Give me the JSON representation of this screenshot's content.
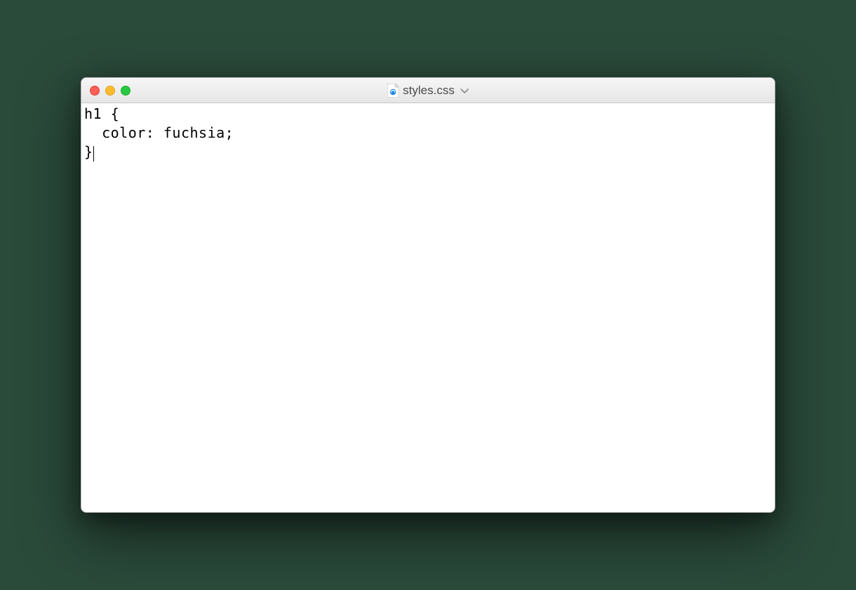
{
  "window": {
    "title": "styles.css",
    "traffic_lights": {
      "close": "close",
      "minimize": "minimize",
      "maximize": "maximize"
    }
  },
  "editor": {
    "lines": [
      "h1 {",
      "  color: fuchsia;",
      "}"
    ],
    "cursor_line": 2,
    "cursor_col": 1
  }
}
